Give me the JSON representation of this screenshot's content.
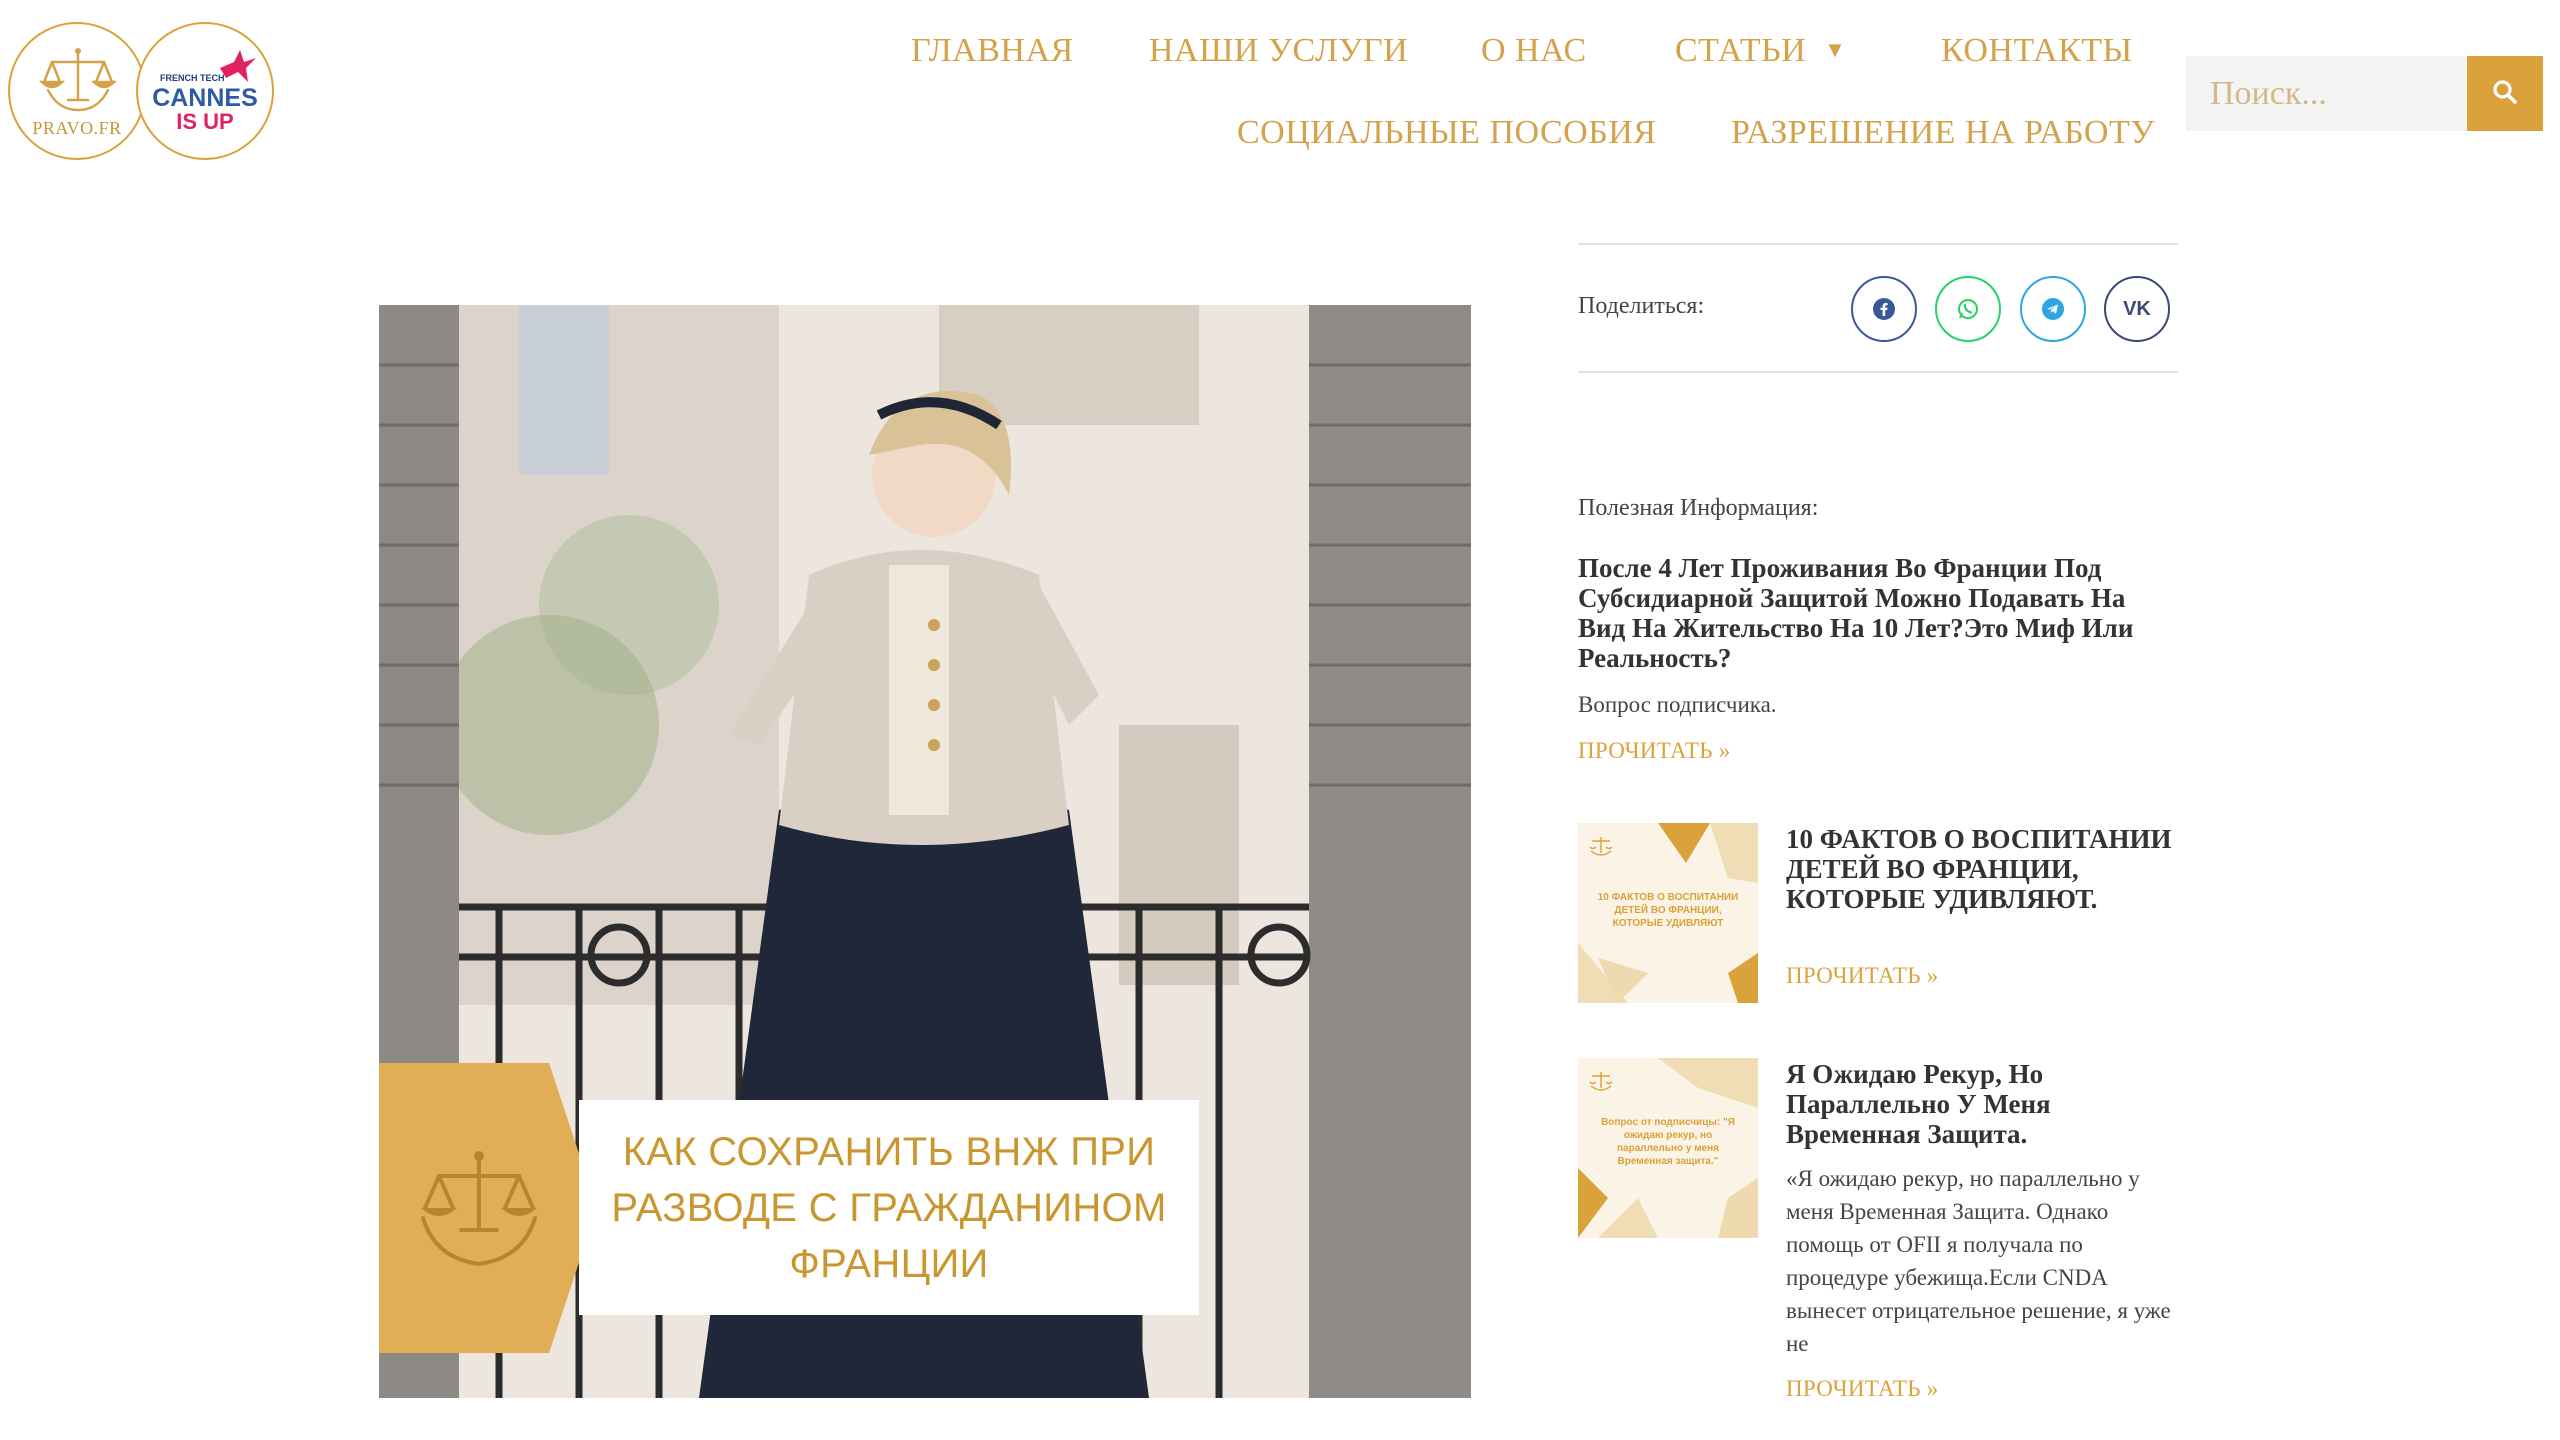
{
  "logos": {
    "pravo_text": "PRAVO.FR",
    "frenchtech_text": "FRENCH TECH",
    "cannes_text": "CANNES",
    "isup_text": "IS UP"
  },
  "nav": {
    "row1": [
      "ГЛАВНАЯ",
      "НАШИ УСЛУГИ",
      "О НАС",
      "СТАТЬИ",
      "КОНТАКТЫ"
    ],
    "row2": [
      "СОЦИАЛЬНЫЕ ПОСОБИЯ",
      "РАЗРЕШЕНИЕ НА РАБОТУ"
    ],
    "dropdown_icon": "caret-down-icon"
  },
  "search": {
    "placeholder": "Поиск...",
    "value": "",
    "icon": "search-icon"
  },
  "hero": {
    "title": "КАК СОХРАНИТЬ ВНЖ ПРИ РАЗВОДЕ С ГРАЖДАНИНОМ ФРАНЦИИ",
    "badge_icon": "scales-laurel-icon"
  },
  "share": {
    "label": "Поделиться:",
    "buttons": [
      {
        "icon": "facebook-icon",
        "color": "#3b5998"
      },
      {
        "icon": "whatsapp-icon",
        "color": "#25d366"
      },
      {
        "icon": "telegram-icon",
        "color": "#2ca5e0"
      },
      {
        "icon": "vk-icon",
        "label": "VK",
        "color": "#3b4a73"
      }
    ]
  },
  "useful": {
    "label": "Полезная Информация:",
    "posts": [
      {
        "title": "После 4 Лет Проживания Во Франции Под Субсидиарной Защитой Можно Подавать На Вид На Жительство На 10 Лет?Это Миф Или Реальность?",
        "excerpt": "Вопрос подписчика.",
        "read_more": "ПРОЧИТАТЬ »"
      },
      {
        "title": "10 ФАКТОВ О ВОСПИТАНИИ ДЕТЕЙ ВО ФРАНЦИИ, КОТОРЫЕ УДИВЛЯЮТ.",
        "thumb_text": "10 ФАКТОВ О ВОСПИТАНИИ ДЕТЕЙ ВО ФРАНЦИИ, КОТОРЫЕ УДИВЛЯЮТ",
        "read_more": "ПРОЧИТАТЬ »"
      },
      {
        "title": "Я Ожидаю Рекур, Но Параллельно У Меня Временная Защита.",
        "thumb_text": "Вопрос от подписчицы: \"Я ожидаю рекур, но параллельно у меня Временная защита.\"",
        "excerpt": "«Я ожидаю рекур, но параллельно у меня Временная Защита. Однако помощь от OFII я получала по процедуре убежища.Если CNDA вынесет отрицательное решение, я уже не",
        "read_more": "ПРОЧИТАТЬ »"
      }
    ]
  },
  "colors": {
    "accent": "#d9a23a",
    "nav_text": "#d3a24a",
    "heading": "#333333"
  }
}
